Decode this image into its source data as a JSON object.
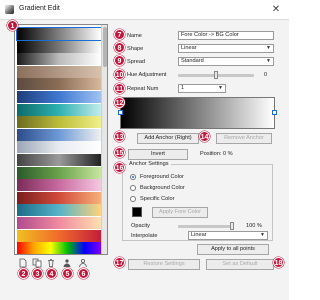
{
  "window": {
    "title": "Gradient Edit",
    "close_glyph": "✕"
  },
  "badges": [
    "1",
    "2",
    "3",
    "4",
    "5",
    "6",
    "7",
    "8",
    "9",
    "10",
    "11",
    "12",
    "13",
    "14",
    "15",
    "16",
    "17",
    "18"
  ],
  "presets": [
    "linear-gradient(to right, #000, #fff)",
    "linear-gradient(to right, #000, #777, #fff)",
    "linear-gradient(to right, #1a1a1a, #bbb, #fff)",
    "linear-gradient(to right, #8a6f5a, #d9c2ae)",
    "linear-gradient(to right, #5b4b3f, #8b6d57, #d7b89b)",
    "linear-gradient(to right, #1f3c7a, #3f78d1, #9fc2f2)",
    "linear-gradient(to right, #0d6b6b, #2fb1b1, #c4ecec)",
    "linear-gradient(to right, #6b6b20, #bcbc3a, #f0f08a)",
    "linear-gradient(to right, #2d4b8a, #6d9ad6, #f0f0f0)",
    "linear-gradient(to right, #9aa6b6, #e8ebf0, #ffffff)",
    "linear-gradient(to right, #444, #9a9a9a, #222)",
    "linear-gradient(to right, #2b5a2b, #6aa24a, #c8e6a0)",
    "linear-gradient(to right, #7a2b5a, #c96aa0, #f4c8e0)",
    "linear-gradient(to right, #7a1e1e, #d24a3a, #f6b07a)",
    "linear-gradient(to right, #1c6b8a, #55b4c8, #ffd27a)",
    "linear-gradient(to right, #b14a8e, #f08aa0, #ffe0b0)",
    "linear-gradient(to right, #f0c020, #f06a2a, #c41e3a)",
    "linear-gradient(to right, #ff0000, #ffa500, #ffff00, #00c000, #0000ff, #8000ff)"
  ],
  "bottom_icons": [
    "new-preset-icon",
    "duplicate-preset-icon",
    "delete-preset-icon",
    "import-preset-icon",
    "export-preset-icon"
  ],
  "name": {
    "label": "Name",
    "value": "Fore Color -> BG Color"
  },
  "shape": {
    "label": "Shape",
    "value": "Linear"
  },
  "spread": {
    "label": "Spread",
    "value": "Standard"
  },
  "hue_adjustment": {
    "label": "Hue Adjustment",
    "value": "0",
    "level": 0.5
  },
  "repeat_num": {
    "label": "Repeat Num",
    "value": "1"
  },
  "buttons": {
    "add_anchor": "Add Anchor (Right)",
    "remove_anchor": "Remove Anchor",
    "invert": "Invert",
    "position": "Position: 0 %",
    "apply_fore_color": "Apply Fore Color",
    "apply_to_all": "Apply to all points",
    "restore_settings": "Restore Settings",
    "set_as_default": "Set as Default"
  },
  "anchor_settings": {
    "title": "Anchor Settings",
    "options": [
      "Foreground Color",
      "Background Color",
      "Specific Color"
    ],
    "selected": 0,
    "opacity_label": "Opacity",
    "opacity_value": "100 %",
    "opacity_level": 1.0,
    "interpolate_label": "Interpolate",
    "interpolate_value": "Linear"
  },
  "colors": {
    "accent": "#1a6fd6",
    "badge": "#c5163a",
    "swatch": "#000000"
  }
}
